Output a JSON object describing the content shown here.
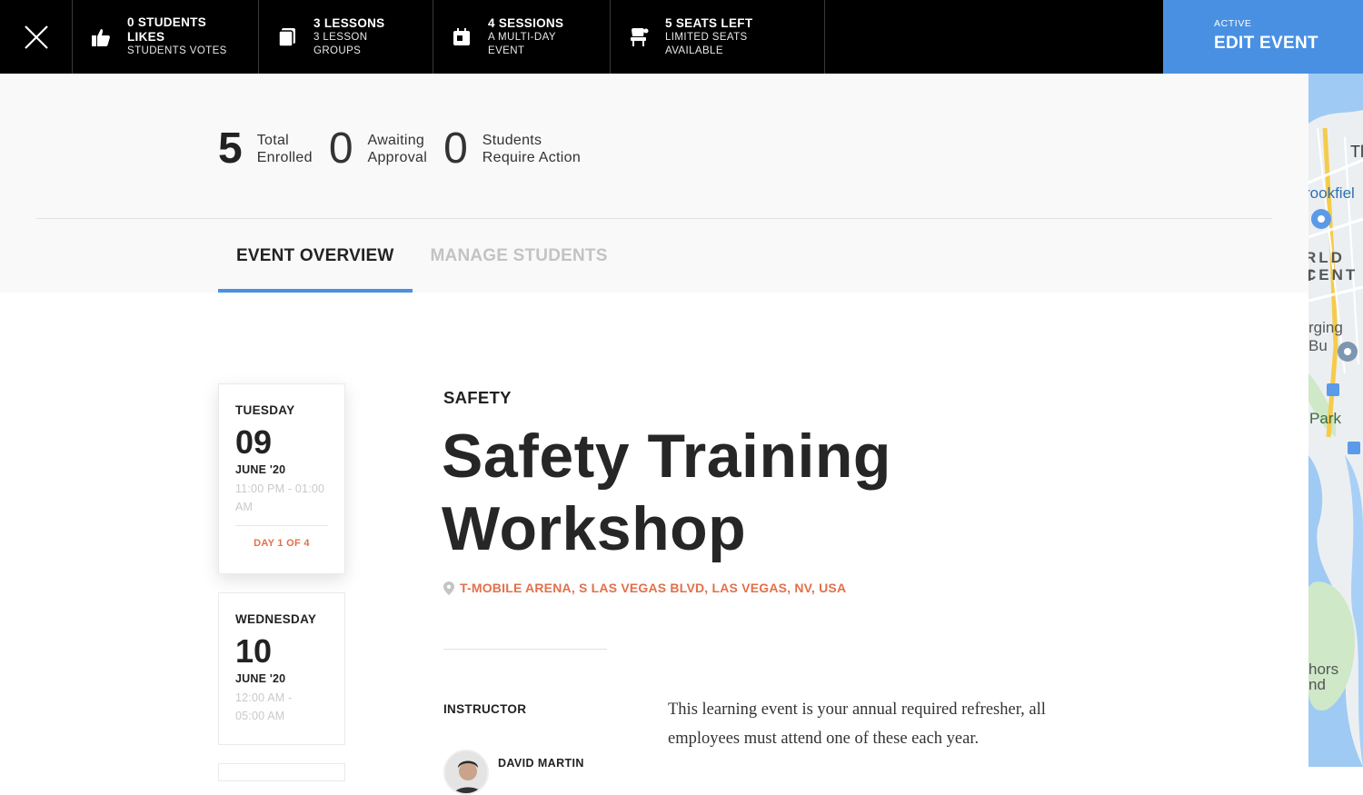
{
  "topbar": {
    "stats": [
      {
        "title": "0 STUDENTS LIKES",
        "subtitle": "STUDENTS VOTES",
        "icon": "thumbs-up-icon"
      },
      {
        "title": "3 LESSONS",
        "subtitle": "3 LESSON GROUPS",
        "icon": "pages-icon"
      },
      {
        "title": "4 SESSIONS",
        "subtitle": "A MULTI-DAY EVENT",
        "icon": "calendar-icon"
      },
      {
        "title": "5 SEATS LEFT",
        "subtitle": "LIMITED SEATS AVAILABLE",
        "icon": "seat-icon"
      }
    ],
    "edit": {
      "status": "ACTIVE",
      "label": "EDIT EVENT"
    }
  },
  "summary": {
    "counts": [
      {
        "value": "5",
        "line1": "Total",
        "line2": "Enrolled"
      },
      {
        "value": "0",
        "line1": "Awaiting",
        "line2": "Approval"
      },
      {
        "value": "0",
        "line1": "Students",
        "line2": "Require Action"
      }
    ],
    "tabs": [
      {
        "label": "EVENT OVERVIEW",
        "active": true
      },
      {
        "label": "MANAGE STUDENTS",
        "active": false
      }
    ]
  },
  "sessions": [
    {
      "weekday": "TUESDAY",
      "day": "09",
      "month": "JUNE '20",
      "time_line1": "11:00 PM - 01:00",
      "time_line2": "AM",
      "day_of": "DAY 1 OF 4"
    },
    {
      "weekday": "WEDNESDAY",
      "day": "10",
      "month": "JUNE '20",
      "time_line1": "12:00 AM -",
      "time_line2": "05:00 AM"
    }
  ],
  "event": {
    "category": "SAFETY",
    "title_line1": "Safety Training",
    "title_line2": "Workshop",
    "location": "T-MOBILE ARENA, S LAS VEGAS BLVD, LAS VEGAS, NV, USA",
    "instructor_label": "INSTRUCTOR",
    "instructor_name": "DAVID MARTIN",
    "description": "This learning event is your annual required refresher, all employees must attend one of these each year."
  },
  "map": {
    "labels": [
      "Tl",
      "rookfiel",
      "RLD T",
      "CENT",
      "rging Bu",
      "Park",
      "hors",
      "nd"
    ]
  },
  "colors": {
    "accent_blue": "#4a90e2",
    "accent_orange": "#e2704a",
    "topbar": "#000000"
  }
}
